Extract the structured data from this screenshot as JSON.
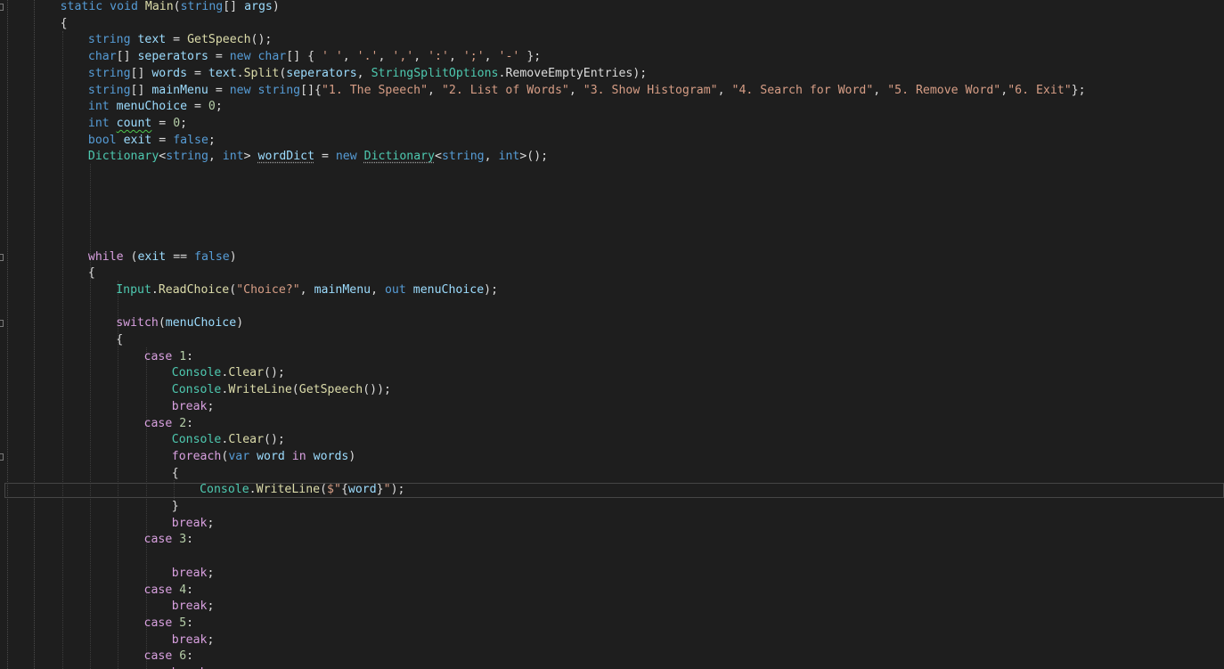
{
  "editor": {
    "colors": {
      "background": "#1e1e1e",
      "plain": "#dcdcdc",
      "keyword": "#569cd6",
      "control": "#d8a0df",
      "type": "#4ec9b0",
      "method": "#dcdcaa",
      "local": "#9cdcfe",
      "string": "#d69d85",
      "number": "#b5cea8"
    },
    "lines": [
      {
        "indent": 2,
        "tokens": [
          [
            "static void ",
            "keyword"
          ],
          [
            "Main",
            "method"
          ],
          [
            "(",
            "plain"
          ],
          [
            "string",
            "keyword"
          ],
          [
            "[] ",
            "plain"
          ],
          [
            "args",
            "local"
          ],
          [
            ")",
            "plain"
          ]
        ]
      },
      {
        "indent": 2,
        "tokens": [
          [
            "{",
            "plain"
          ]
        ]
      },
      {
        "indent": 3,
        "tokens": [
          [
            "string ",
            "keyword"
          ],
          [
            "text",
            "local"
          ],
          [
            " = ",
            "plain"
          ],
          [
            "GetSpeech",
            "method"
          ],
          [
            "();",
            "plain"
          ]
        ]
      },
      {
        "indent": 3,
        "tokens": [
          [
            "char",
            "keyword"
          ],
          [
            "[] ",
            "plain"
          ],
          [
            "seperators",
            "local"
          ],
          [
            " = ",
            "plain"
          ],
          [
            "new ",
            "keyword"
          ],
          [
            "char",
            "keyword"
          ],
          [
            "[] { ",
            "plain"
          ],
          [
            "' '",
            "string"
          ],
          [
            ", ",
            "plain"
          ],
          [
            "'.'",
            "string"
          ],
          [
            ", ",
            "plain"
          ],
          [
            "','",
            "string"
          ],
          [
            ", ",
            "plain"
          ],
          [
            "':'",
            "string"
          ],
          [
            ", ",
            "plain"
          ],
          [
            "';'",
            "string"
          ],
          [
            ", ",
            "plain"
          ],
          [
            "'-'",
            "string"
          ],
          [
            " };",
            "plain"
          ]
        ]
      },
      {
        "indent": 3,
        "tokens": [
          [
            "string",
            "keyword"
          ],
          [
            "[] ",
            "plain"
          ],
          [
            "words",
            "local"
          ],
          [
            " = ",
            "plain"
          ],
          [
            "text",
            "local"
          ],
          [
            ".",
            "plain"
          ],
          [
            "Split",
            "method"
          ],
          [
            "(",
            "plain"
          ],
          [
            "seperators",
            "local"
          ],
          [
            ", ",
            "plain"
          ],
          [
            "StringSplitOptions",
            "type"
          ],
          [
            ".",
            "plain"
          ],
          [
            "RemoveEmptyEntries",
            "plain"
          ],
          [
            ");",
            "plain"
          ]
        ]
      },
      {
        "indent": 3,
        "tokens": [
          [
            "string",
            "keyword"
          ],
          [
            "[] ",
            "plain"
          ],
          [
            "mainMenu",
            "local"
          ],
          [
            " = ",
            "plain"
          ],
          [
            "new ",
            "keyword"
          ],
          [
            "string",
            "keyword"
          ],
          [
            "[]{",
            "plain"
          ],
          [
            "\"1. The Speech\"",
            "string"
          ],
          [
            ", ",
            "plain"
          ],
          [
            "\"2. List of Words\"",
            "string"
          ],
          [
            ", ",
            "plain"
          ],
          [
            "\"3. Show Histogram\"",
            "string"
          ],
          [
            ", ",
            "plain"
          ],
          [
            "\"4. Search for Word\"",
            "string"
          ],
          [
            ", ",
            "plain"
          ],
          [
            "\"5. Remove Word\"",
            "string"
          ],
          [
            ",",
            "plain"
          ],
          [
            "\"6. Exit\"",
            "string"
          ],
          [
            "};",
            "plain"
          ]
        ]
      },
      {
        "indent": 3,
        "tokens": [
          [
            "int ",
            "keyword"
          ],
          [
            "menuChoice",
            "local"
          ],
          [
            " = ",
            "plain"
          ],
          [
            "0",
            "number"
          ],
          [
            ";",
            "plain"
          ]
        ]
      },
      {
        "indent": 3,
        "tokens": [
          [
            "int ",
            "keyword"
          ],
          [
            "count",
            "local",
            "squiggle"
          ],
          [
            " = ",
            "plain"
          ],
          [
            "0",
            "number"
          ],
          [
            ";",
            "plain"
          ]
        ]
      },
      {
        "indent": 3,
        "tokens": [
          [
            "bool ",
            "keyword"
          ],
          [
            "exit",
            "local"
          ],
          [
            " = ",
            "plain"
          ],
          [
            "false",
            "keyword"
          ],
          [
            ";",
            "plain"
          ]
        ]
      },
      {
        "indent": 3,
        "tokens": [
          [
            "Dictionary",
            "type"
          ],
          [
            "<",
            "plain"
          ],
          [
            "string",
            "keyword"
          ],
          [
            ", ",
            "plain"
          ],
          [
            "int",
            "keyword"
          ],
          [
            "> ",
            "plain"
          ],
          [
            "wordDict",
            "local",
            "dots"
          ],
          [
            " = ",
            "plain"
          ],
          [
            "new ",
            "keyword"
          ],
          [
            "Dictionary",
            "type",
            "dots"
          ],
          [
            "<",
            "plain"
          ],
          [
            "string",
            "keyword"
          ],
          [
            ", ",
            "plain"
          ],
          [
            "int",
            "keyword"
          ],
          [
            ">();",
            "plain"
          ]
        ]
      },
      {
        "indent": 3,
        "tokens": []
      },
      {
        "indent": 3,
        "tokens": []
      },
      {
        "indent": 3,
        "tokens": []
      },
      {
        "indent": 3,
        "tokens": []
      },
      {
        "indent": 3,
        "tokens": []
      },
      {
        "indent": 3,
        "tokens": [
          [
            "while",
            "control"
          ],
          [
            " (",
            "plain"
          ],
          [
            "exit",
            "local"
          ],
          [
            " == ",
            "plain"
          ],
          [
            "false",
            "keyword"
          ],
          [
            ")",
            "plain"
          ]
        ]
      },
      {
        "indent": 3,
        "tokens": [
          [
            "{",
            "plain"
          ]
        ]
      },
      {
        "indent": 4,
        "tokens": [
          [
            "Input",
            "type"
          ],
          [
            ".",
            "plain"
          ],
          [
            "ReadChoice",
            "method"
          ],
          [
            "(",
            "plain"
          ],
          [
            "\"Choice?\"",
            "string"
          ],
          [
            ", ",
            "plain"
          ],
          [
            "mainMenu",
            "local"
          ],
          [
            ", ",
            "plain"
          ],
          [
            "out ",
            "keyword"
          ],
          [
            "menuChoice",
            "local"
          ],
          [
            ");",
            "plain"
          ]
        ]
      },
      {
        "indent": 4,
        "tokens": []
      },
      {
        "indent": 4,
        "tokens": [
          [
            "switch",
            "control"
          ],
          [
            "(",
            "plain"
          ],
          [
            "menuChoice",
            "local"
          ],
          [
            ")",
            "plain"
          ]
        ]
      },
      {
        "indent": 4,
        "tokens": [
          [
            "{",
            "plain"
          ]
        ]
      },
      {
        "indent": 5,
        "tokens": [
          [
            "case ",
            "control"
          ],
          [
            "1",
            "number"
          ],
          [
            ":",
            "plain"
          ]
        ]
      },
      {
        "indent": 6,
        "tokens": [
          [
            "Console",
            "type"
          ],
          [
            ".",
            "plain"
          ],
          [
            "Clear",
            "method"
          ],
          [
            "();",
            "plain"
          ]
        ]
      },
      {
        "indent": 6,
        "tokens": [
          [
            "Console",
            "type"
          ],
          [
            ".",
            "plain"
          ],
          [
            "WriteLine",
            "method"
          ],
          [
            "(",
            "plain"
          ],
          [
            "GetSpeech",
            "method"
          ],
          [
            "());",
            "plain"
          ]
        ]
      },
      {
        "indent": 6,
        "tokens": [
          [
            "break",
            "control"
          ],
          [
            ";",
            "plain"
          ]
        ]
      },
      {
        "indent": 5,
        "tokens": [
          [
            "case ",
            "control"
          ],
          [
            "2",
            "number"
          ],
          [
            ":",
            "plain"
          ]
        ]
      },
      {
        "indent": 6,
        "tokens": [
          [
            "Console",
            "type"
          ],
          [
            ".",
            "plain"
          ],
          [
            "Clear",
            "method"
          ],
          [
            "();",
            "plain"
          ]
        ]
      },
      {
        "indent": 6,
        "tokens": [
          [
            "foreach",
            "control"
          ],
          [
            "(",
            "plain"
          ],
          [
            "var ",
            "keyword"
          ],
          [
            "word",
            "local"
          ],
          [
            " in ",
            "control"
          ],
          [
            "words",
            "local"
          ],
          [
            ")",
            "plain"
          ]
        ]
      },
      {
        "indent": 6,
        "tokens": [
          [
            "{",
            "plain"
          ]
        ]
      },
      {
        "indent": 7,
        "current": true,
        "tokens": [
          [
            "Console",
            "type"
          ],
          [
            ".",
            "plain"
          ],
          [
            "WriteLine",
            "method"
          ],
          [
            "(",
            "plain"
          ],
          [
            "$\"",
            "string"
          ],
          [
            "{",
            "plain"
          ],
          [
            "word",
            "local"
          ],
          [
            "}",
            "plain"
          ],
          [
            "\"",
            "string"
          ],
          [
            ");",
            "plain"
          ]
        ]
      },
      {
        "indent": 6,
        "tokens": [
          [
            "}",
            "plain"
          ]
        ]
      },
      {
        "indent": 6,
        "tokens": [
          [
            "break",
            "control"
          ],
          [
            ";",
            "plain"
          ]
        ]
      },
      {
        "indent": 5,
        "tokens": [
          [
            "case ",
            "control"
          ],
          [
            "3",
            "number"
          ],
          [
            ":",
            "plain"
          ]
        ]
      },
      {
        "indent": 6,
        "tokens": []
      },
      {
        "indent": 6,
        "tokens": [
          [
            "break",
            "control"
          ],
          [
            ";",
            "plain"
          ]
        ]
      },
      {
        "indent": 5,
        "tokens": [
          [
            "case ",
            "control"
          ],
          [
            "4",
            "number"
          ],
          [
            ":",
            "plain"
          ]
        ]
      },
      {
        "indent": 6,
        "tokens": [
          [
            "break",
            "control"
          ],
          [
            ";",
            "plain"
          ]
        ]
      },
      {
        "indent": 5,
        "tokens": [
          [
            "case ",
            "control"
          ],
          [
            "5",
            "number"
          ],
          [
            ":",
            "plain"
          ]
        ]
      },
      {
        "indent": 6,
        "tokens": [
          [
            "break",
            "control"
          ],
          [
            ";",
            "plain"
          ]
        ]
      },
      {
        "indent": 5,
        "tokens": [
          [
            "case ",
            "control"
          ],
          [
            "6",
            "number"
          ],
          [
            ":",
            "plain"
          ]
        ]
      },
      {
        "indent": 6,
        "tokens": [
          [
            "break",
            "control"
          ],
          [
            ";",
            "plain"
          ]
        ]
      }
    ]
  }
}
